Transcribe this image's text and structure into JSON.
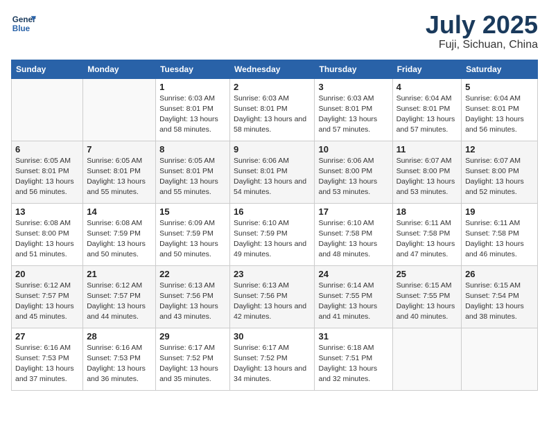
{
  "header": {
    "logo_line1": "General",
    "logo_line2": "Blue",
    "month_year": "July 2025",
    "location": "Fuji, Sichuan, China"
  },
  "weekdays": [
    "Sunday",
    "Monday",
    "Tuesday",
    "Wednesday",
    "Thursday",
    "Friday",
    "Saturday"
  ],
  "weeks": [
    [
      {
        "day": "",
        "info": ""
      },
      {
        "day": "",
        "info": ""
      },
      {
        "day": "1",
        "info": "Sunrise: 6:03 AM\nSunset: 8:01 PM\nDaylight: 13 hours\nand 58 minutes."
      },
      {
        "day": "2",
        "info": "Sunrise: 6:03 AM\nSunset: 8:01 PM\nDaylight: 13 hours\nand 58 minutes."
      },
      {
        "day": "3",
        "info": "Sunrise: 6:03 AM\nSunset: 8:01 PM\nDaylight: 13 hours\nand 57 minutes."
      },
      {
        "day": "4",
        "info": "Sunrise: 6:04 AM\nSunset: 8:01 PM\nDaylight: 13 hours\nand 57 minutes."
      },
      {
        "day": "5",
        "info": "Sunrise: 6:04 AM\nSunset: 8:01 PM\nDaylight: 13 hours\nand 56 minutes."
      }
    ],
    [
      {
        "day": "6",
        "info": "Sunrise: 6:05 AM\nSunset: 8:01 PM\nDaylight: 13 hours\nand 56 minutes."
      },
      {
        "day": "7",
        "info": "Sunrise: 6:05 AM\nSunset: 8:01 PM\nDaylight: 13 hours\nand 55 minutes."
      },
      {
        "day": "8",
        "info": "Sunrise: 6:05 AM\nSunset: 8:01 PM\nDaylight: 13 hours\nand 55 minutes."
      },
      {
        "day": "9",
        "info": "Sunrise: 6:06 AM\nSunset: 8:01 PM\nDaylight: 13 hours\nand 54 minutes."
      },
      {
        "day": "10",
        "info": "Sunrise: 6:06 AM\nSunset: 8:00 PM\nDaylight: 13 hours\nand 53 minutes."
      },
      {
        "day": "11",
        "info": "Sunrise: 6:07 AM\nSunset: 8:00 PM\nDaylight: 13 hours\nand 53 minutes."
      },
      {
        "day": "12",
        "info": "Sunrise: 6:07 AM\nSunset: 8:00 PM\nDaylight: 13 hours\nand 52 minutes."
      }
    ],
    [
      {
        "day": "13",
        "info": "Sunrise: 6:08 AM\nSunset: 8:00 PM\nDaylight: 13 hours\nand 51 minutes."
      },
      {
        "day": "14",
        "info": "Sunrise: 6:08 AM\nSunset: 7:59 PM\nDaylight: 13 hours\nand 50 minutes."
      },
      {
        "day": "15",
        "info": "Sunrise: 6:09 AM\nSunset: 7:59 PM\nDaylight: 13 hours\nand 50 minutes."
      },
      {
        "day": "16",
        "info": "Sunrise: 6:10 AM\nSunset: 7:59 PM\nDaylight: 13 hours\nand 49 minutes."
      },
      {
        "day": "17",
        "info": "Sunrise: 6:10 AM\nSunset: 7:58 PM\nDaylight: 13 hours\nand 48 minutes."
      },
      {
        "day": "18",
        "info": "Sunrise: 6:11 AM\nSunset: 7:58 PM\nDaylight: 13 hours\nand 47 minutes."
      },
      {
        "day": "19",
        "info": "Sunrise: 6:11 AM\nSunset: 7:58 PM\nDaylight: 13 hours\nand 46 minutes."
      }
    ],
    [
      {
        "day": "20",
        "info": "Sunrise: 6:12 AM\nSunset: 7:57 PM\nDaylight: 13 hours\nand 45 minutes."
      },
      {
        "day": "21",
        "info": "Sunrise: 6:12 AM\nSunset: 7:57 PM\nDaylight: 13 hours\nand 44 minutes."
      },
      {
        "day": "22",
        "info": "Sunrise: 6:13 AM\nSunset: 7:56 PM\nDaylight: 13 hours\nand 43 minutes."
      },
      {
        "day": "23",
        "info": "Sunrise: 6:13 AM\nSunset: 7:56 PM\nDaylight: 13 hours\nand 42 minutes."
      },
      {
        "day": "24",
        "info": "Sunrise: 6:14 AM\nSunset: 7:55 PM\nDaylight: 13 hours\nand 41 minutes."
      },
      {
        "day": "25",
        "info": "Sunrise: 6:15 AM\nSunset: 7:55 PM\nDaylight: 13 hours\nand 40 minutes."
      },
      {
        "day": "26",
        "info": "Sunrise: 6:15 AM\nSunset: 7:54 PM\nDaylight: 13 hours\nand 38 minutes."
      }
    ],
    [
      {
        "day": "27",
        "info": "Sunrise: 6:16 AM\nSunset: 7:53 PM\nDaylight: 13 hours\nand 37 minutes."
      },
      {
        "day": "28",
        "info": "Sunrise: 6:16 AM\nSunset: 7:53 PM\nDaylight: 13 hours\nand 36 minutes."
      },
      {
        "day": "29",
        "info": "Sunrise: 6:17 AM\nSunset: 7:52 PM\nDaylight: 13 hours\nand 35 minutes."
      },
      {
        "day": "30",
        "info": "Sunrise: 6:17 AM\nSunset: 7:52 PM\nDaylight: 13 hours\nand 34 minutes."
      },
      {
        "day": "31",
        "info": "Sunrise: 6:18 AM\nSunset: 7:51 PM\nDaylight: 13 hours\nand 32 minutes."
      },
      {
        "day": "",
        "info": ""
      },
      {
        "day": "",
        "info": ""
      }
    ]
  ]
}
